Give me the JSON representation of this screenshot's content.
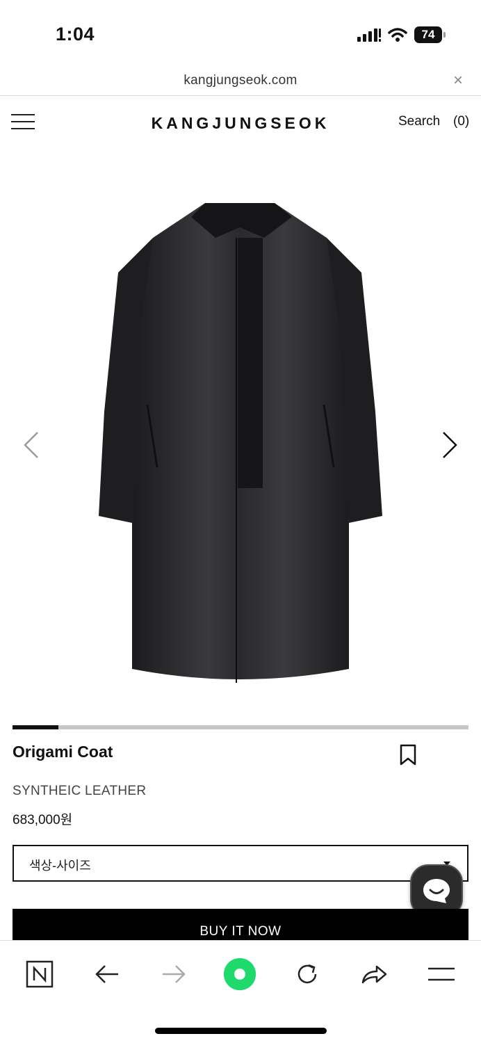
{
  "status": {
    "time": "1:04",
    "battery": "74"
  },
  "browser": {
    "url": "kangjungseok.com",
    "close_label": "×"
  },
  "header": {
    "logo": "KANGJUNGSEOK",
    "search_label": "Search",
    "cart_label": "(0)"
  },
  "gallery": {
    "image_icon": "coat-image",
    "progress": 0.1
  },
  "product": {
    "title": "Origami Coat",
    "material": "SYNTHEIC LEATHER",
    "price": "683,000원",
    "option_placeholder": "색상-사이즈",
    "buy_label": "BUY IT NOW"
  },
  "toolbar": {
    "icons": [
      "naver-n-icon",
      "back-arrow-icon",
      "forward-arrow-icon",
      "green-circle-icon",
      "reload-icon",
      "share-icon",
      "menu-lines-icon"
    ]
  }
}
